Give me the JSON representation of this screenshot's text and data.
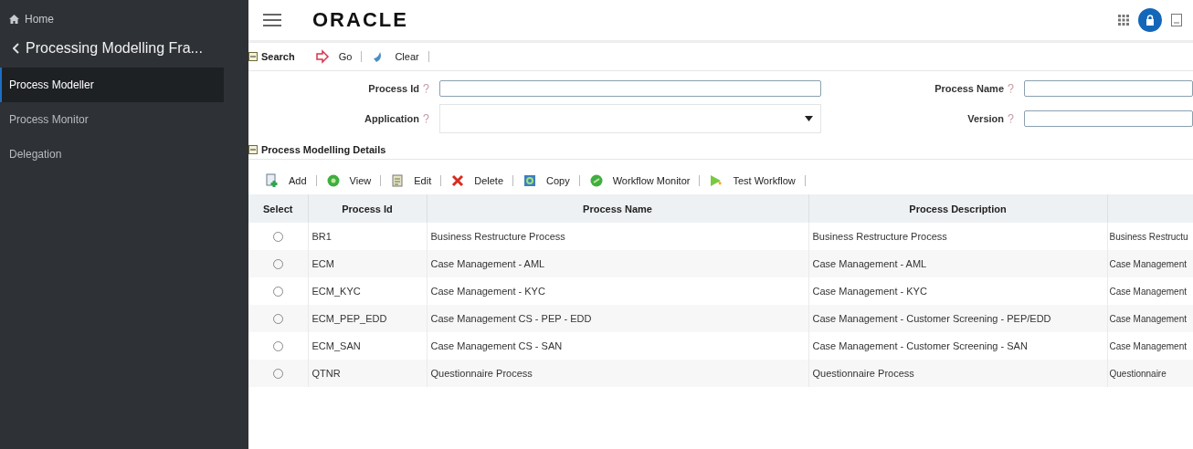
{
  "sidebar": {
    "home": "Home",
    "back_title": "Processing Modelling Fra...",
    "items": [
      {
        "label": "Process Modeller",
        "selected": true
      },
      {
        "label": "Process Monitor",
        "selected": false
      },
      {
        "label": "Delegation",
        "selected": false
      }
    ]
  },
  "header": {
    "logo": "ORACLE"
  },
  "search": {
    "title": "Search",
    "actions": [
      {
        "label": "Go",
        "kind": "go"
      },
      {
        "label": "Clear",
        "kind": "clear"
      }
    ],
    "fields": [
      {
        "label": "Process Id",
        "kind": "text"
      },
      {
        "label": "Process Name",
        "kind": "text"
      },
      {
        "label": "Application",
        "kind": "select"
      },
      {
        "label": "Version",
        "kind": "text"
      }
    ]
  },
  "details": {
    "title": "Process Modelling Details",
    "actions": [
      {
        "label": "Add",
        "kind": "add"
      },
      {
        "label": "View",
        "kind": "view"
      },
      {
        "label": "Edit",
        "kind": "edit"
      },
      {
        "label": "Delete",
        "kind": "delete"
      },
      {
        "label": "Copy",
        "kind": "copy"
      },
      {
        "label": "Workflow Monitor",
        "kind": "monitor"
      },
      {
        "label": "Test Workflow",
        "kind": "test"
      }
    ]
  },
  "table": {
    "columns": [
      "Select",
      "Process Id",
      "Process Name",
      "Process Description",
      ""
    ],
    "rows": [
      {
        "selected": false,
        "cells": [
          "",
          "BR1",
          "Business Restructure Process",
          "Business Restructure Process",
          "Business Restructu"
        ]
      },
      {
        "selected": false,
        "cells": [
          "",
          "ECM",
          "Case Management - AML",
          "Case Management - AML",
          "Case Management"
        ]
      },
      {
        "selected": false,
        "cells": [
          "",
          "ECM_KYC",
          "Case Management - KYC",
          "Case Management - KYC",
          "Case Management"
        ]
      },
      {
        "selected": false,
        "cells": [
          "",
          "ECM_PEP_EDD",
          "Case Management CS - PEP - EDD",
          "Case Management - Customer Screening - PEP/EDD",
          "Case Management"
        ]
      },
      {
        "selected": false,
        "cells": [
          "",
          "ECM_SAN",
          "Case Management CS - SAN",
          "Case Management - Customer Screening - SAN",
          "Case Management"
        ]
      },
      {
        "selected": false,
        "cells": [
          "",
          "QTNR",
          "Questionnaire Process",
          "Questionnaire Process",
          "Questionnaire"
        ]
      }
    ]
  }
}
